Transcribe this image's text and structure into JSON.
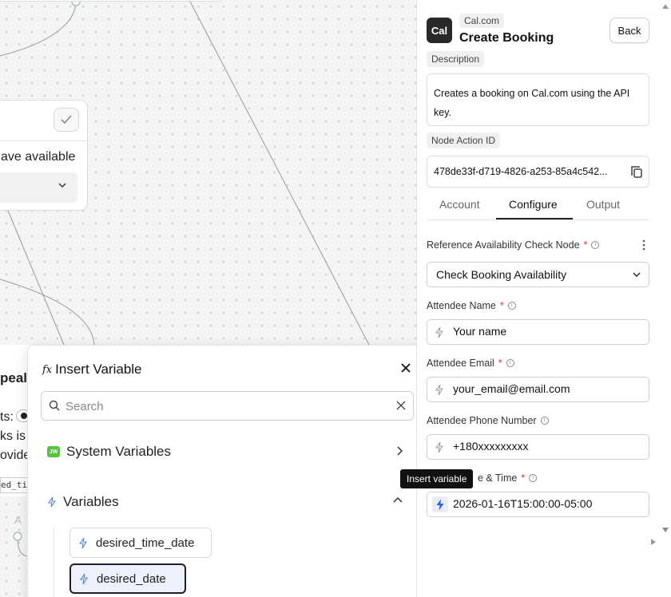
{
  "canvas": {
    "mid_node": {
      "label_fragment": "ave available"
    },
    "low_node": {
      "heading_fragment": "peal",
      "line1_fragment": "ts:",
      "line2_fragment": "ks is",
      "line3_fragment": "ovide",
      "code_fragment": "ed_ti",
      "handle_letter": "A"
    }
  },
  "insert_variable": {
    "title_prefix": "fx",
    "title": "Insert Variable",
    "search_placeholder": "Search",
    "system_badge": "JW",
    "system_label": "System Variables",
    "variables_label": "Variables",
    "items": [
      "desired_time_date",
      "desired_date"
    ]
  },
  "panel": {
    "app_logo": "Cal",
    "app_tag": "Cal.com",
    "title": "Create Booking",
    "back_label": "Back",
    "description_tag": "Description",
    "description": "Creates a booking on Cal.com using the API key.",
    "node_id_tag": "Node Action ID",
    "node_id": "478de33f-d719-4826-a253-85a4c542...",
    "tabs": [
      "Account",
      "Configure",
      "Output"
    ],
    "active_tab": "Configure",
    "fields": {
      "ref_label": "Reference Availability Check Node",
      "ref_value": "Check Booking Availability",
      "name_label": "Attendee Name",
      "name_value": "Your name",
      "email_label": "Attendee Email",
      "email_value": "your_email@email.com",
      "phone_label": "Attendee Phone Number",
      "phone_value": "+180xxxxxxxxx",
      "datetime_label_fragment": "e & Time",
      "datetime_value": "2026-01-16T15:00:00-05:00"
    },
    "required_mark": "*",
    "info_mark": "i",
    "tooltip": "Insert variable"
  },
  "colors": {
    "accent": "#2563eb",
    "required": "#e03030",
    "badge_green": "#56c43a"
  }
}
